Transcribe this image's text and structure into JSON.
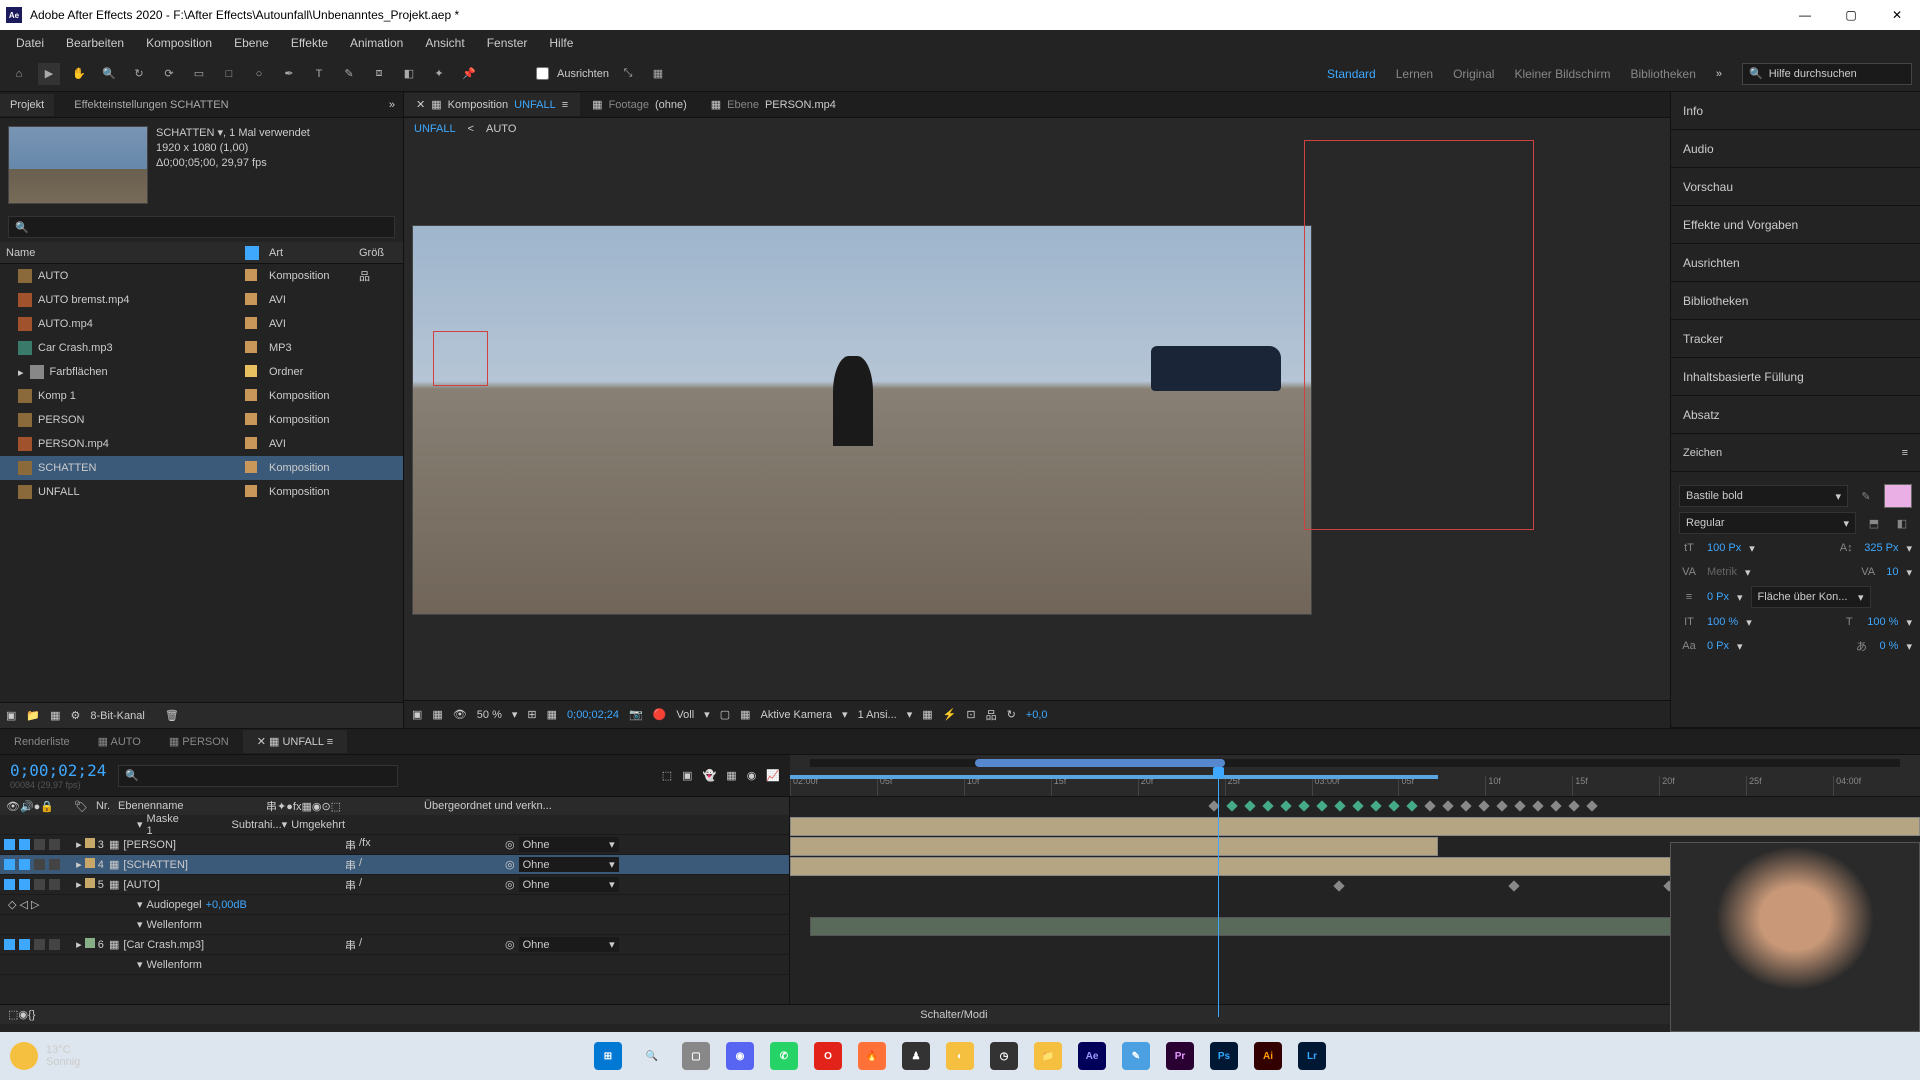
{
  "titlebar": {
    "title": "Adobe After Effects 2020 - F:\\After Effects\\Autounfall\\Unbenanntes_Projekt.aep *"
  },
  "menu": [
    "Datei",
    "Bearbeiten",
    "Komposition",
    "Ebene",
    "Effekte",
    "Animation",
    "Ansicht",
    "Fenster",
    "Hilfe"
  ],
  "toolbar": {
    "align": "Ausrichten",
    "workspaces": [
      "Standard",
      "Lernen",
      "Original",
      "Kleiner Bildschirm",
      "Bibliotheken"
    ],
    "helpsearch": "Hilfe durchsuchen"
  },
  "project": {
    "tab": "Projekt",
    "effect_tab": "Effekteinstellungen SCHATTEN",
    "header": {
      "name": "SCHATTEN",
      "used": ", 1 Mal verwendet",
      "dims": "1920 x 1080 (1,00)",
      "dur": "Δ0;00;05;00, 29,97 fps"
    },
    "cols": [
      "Name",
      "",
      "Art",
      "Größ"
    ],
    "items": [
      {
        "name": "AUTO",
        "type": "Komposition",
        "icon": "comp",
        "swatch": "#c9975a",
        "extra": "品"
      },
      {
        "name": "AUTO bremst.mp4",
        "type": "AVI",
        "icon": "vid",
        "swatch": "#c9975a"
      },
      {
        "name": "AUTO.mp4",
        "type": "AVI",
        "icon": "vid",
        "swatch": "#c9975a"
      },
      {
        "name": "Car Crash.mp3",
        "type": "MP3",
        "icon": "aud",
        "swatch": "#c9975a"
      },
      {
        "name": "Farbflächen",
        "type": "Ordner",
        "icon": "fld",
        "swatch": "#e8c060",
        "exp": true
      },
      {
        "name": "Komp 1",
        "type": "Komposition",
        "icon": "comp",
        "swatch": "#c9975a"
      },
      {
        "name": "PERSON",
        "type": "Komposition",
        "icon": "comp",
        "swatch": "#c9975a"
      },
      {
        "name": "PERSON.mp4",
        "type": "AVI",
        "icon": "vid",
        "swatch": "#c9975a"
      },
      {
        "name": "SCHATTEN",
        "type": "Komposition",
        "icon": "comp",
        "swatch": "#c9975a",
        "sel": true
      },
      {
        "name": "UNFALL",
        "type": "Komposition",
        "icon": "comp",
        "swatch": "#c9975a"
      }
    ],
    "footer": "8-Bit-Kanal"
  },
  "center": {
    "tabs": [
      {
        "prefix": "Komposition ",
        "name": "UNFALL",
        "active": true
      },
      {
        "prefix": "Footage ",
        "name": "(ohne)"
      },
      {
        "prefix": "Ebene ",
        "name": "PERSON.mp4"
      }
    ],
    "bread": [
      "UNFALL",
      "<",
      "AUTO"
    ],
    "ctrl": {
      "zoom": "50 %",
      "res": "Voll",
      "time": "0;00;02;24",
      "camera": "Aktive Kamera",
      "views": "1 Ansi...",
      "exp": "+0,0"
    }
  },
  "right": {
    "sections": [
      "Info",
      "Audio",
      "Vorschau",
      "Effekte und Vorgaben",
      "Ausrichten",
      "Bibliotheken",
      "Tracker",
      "Inhaltsbasierte Füllung",
      "Absatz"
    ],
    "char": {
      "title": "Zeichen",
      "font": "Bastile bold",
      "style": "Regular",
      "size": "100 Px",
      "leading": "325 Px",
      "kern": "Metrik",
      "track": "10",
      "stroke": "0 Px",
      "strokemode": "Fläche über Kon...",
      "hscale": "100 %",
      "vscale": "100 %",
      "baseline": "0 Px",
      "tsume": "0 %"
    }
  },
  "timeline": {
    "tabs": [
      "Renderliste",
      "AUTO",
      "PERSON",
      "UNFALL"
    ],
    "active": "UNFALL",
    "timecode": "0;00;02;24",
    "frames": "00084 (29,97 fps)",
    "ticks": [
      "02:00f",
      "05f",
      "10f",
      "15f",
      "20f",
      "25f",
      "03:00f",
      "05f",
      "10f",
      "15f",
      "20f",
      "25f",
      "04:00f"
    ],
    "colhdr": {
      "nr": "Nr.",
      "name": "Ebenenname",
      "parent": "Übergeordnet und verkn..."
    },
    "layers": [
      {
        "indent": 2,
        "name": "Maske 1",
        "mode": "Subtrahi",
        "inv": "Umgekehrt",
        "swatch": "#e8c060"
      },
      {
        "nr": "3",
        "name": "[PERSON]",
        "swatch": "#c8a868",
        "parent": "Ohne",
        "brackets": true,
        "fx": true
      },
      {
        "nr": "4",
        "name": "[SCHATTEN]",
        "swatch": "#c8a868",
        "parent": "Ohne",
        "brackets": true,
        "sel": true
      },
      {
        "nr": "5",
        "name": "[AUTO]",
        "swatch": "#c8a868",
        "parent": "Ohne",
        "brackets": true
      },
      {
        "indent": 2,
        "name": "Audiopegel",
        "val": "+0,00dB",
        "kf": true
      },
      {
        "indent": 2,
        "name": "Wellenform"
      },
      {
        "nr": "6",
        "name": "[Car Crash.mp3]",
        "swatch": "#88b088",
        "parent": "Ohne",
        "brackets": true
      },
      {
        "indent": 2,
        "name": "Wellenform"
      }
    ],
    "footer": "Schalter/Modi"
  },
  "taskbar": {
    "weather": {
      "temp": "13°C",
      "cond": "Sonnig"
    },
    "apps": [
      {
        "bg": "#0078d4",
        "txt": "⊞"
      },
      {
        "bg": "transparent",
        "txt": "🔍"
      },
      {
        "bg": "#888",
        "txt": "▢"
      },
      {
        "bg": "#5865f2",
        "txt": "◉"
      },
      {
        "bg": "#25d366",
        "txt": "✆"
      },
      {
        "bg": "#e2231a",
        "txt": "O"
      },
      {
        "bg": "#ff7139",
        "txt": "🔥"
      },
      {
        "bg": "#333",
        "txt": "♟"
      },
      {
        "bg": "#f5c040",
        "txt": "◐"
      },
      {
        "bg": "#333",
        "txt": "◷"
      },
      {
        "bg": "#f5c040",
        "txt": "📁"
      },
      {
        "bg": "#00005b",
        "txt": "Ae",
        "fg": "#9999ff"
      },
      {
        "bg": "#4aa0e0",
        "txt": "✎"
      },
      {
        "bg": "#2a0033",
        "txt": "Pr",
        "fg": "#e599ff"
      },
      {
        "bg": "#001833",
        "txt": "Ps",
        "fg": "#31a8ff"
      },
      {
        "bg": "#330000",
        "txt": "Ai",
        "fg": "#ff9a00"
      },
      {
        "bg": "#001833",
        "txt": "Lr",
        "fg": "#31a8ff"
      }
    ]
  }
}
